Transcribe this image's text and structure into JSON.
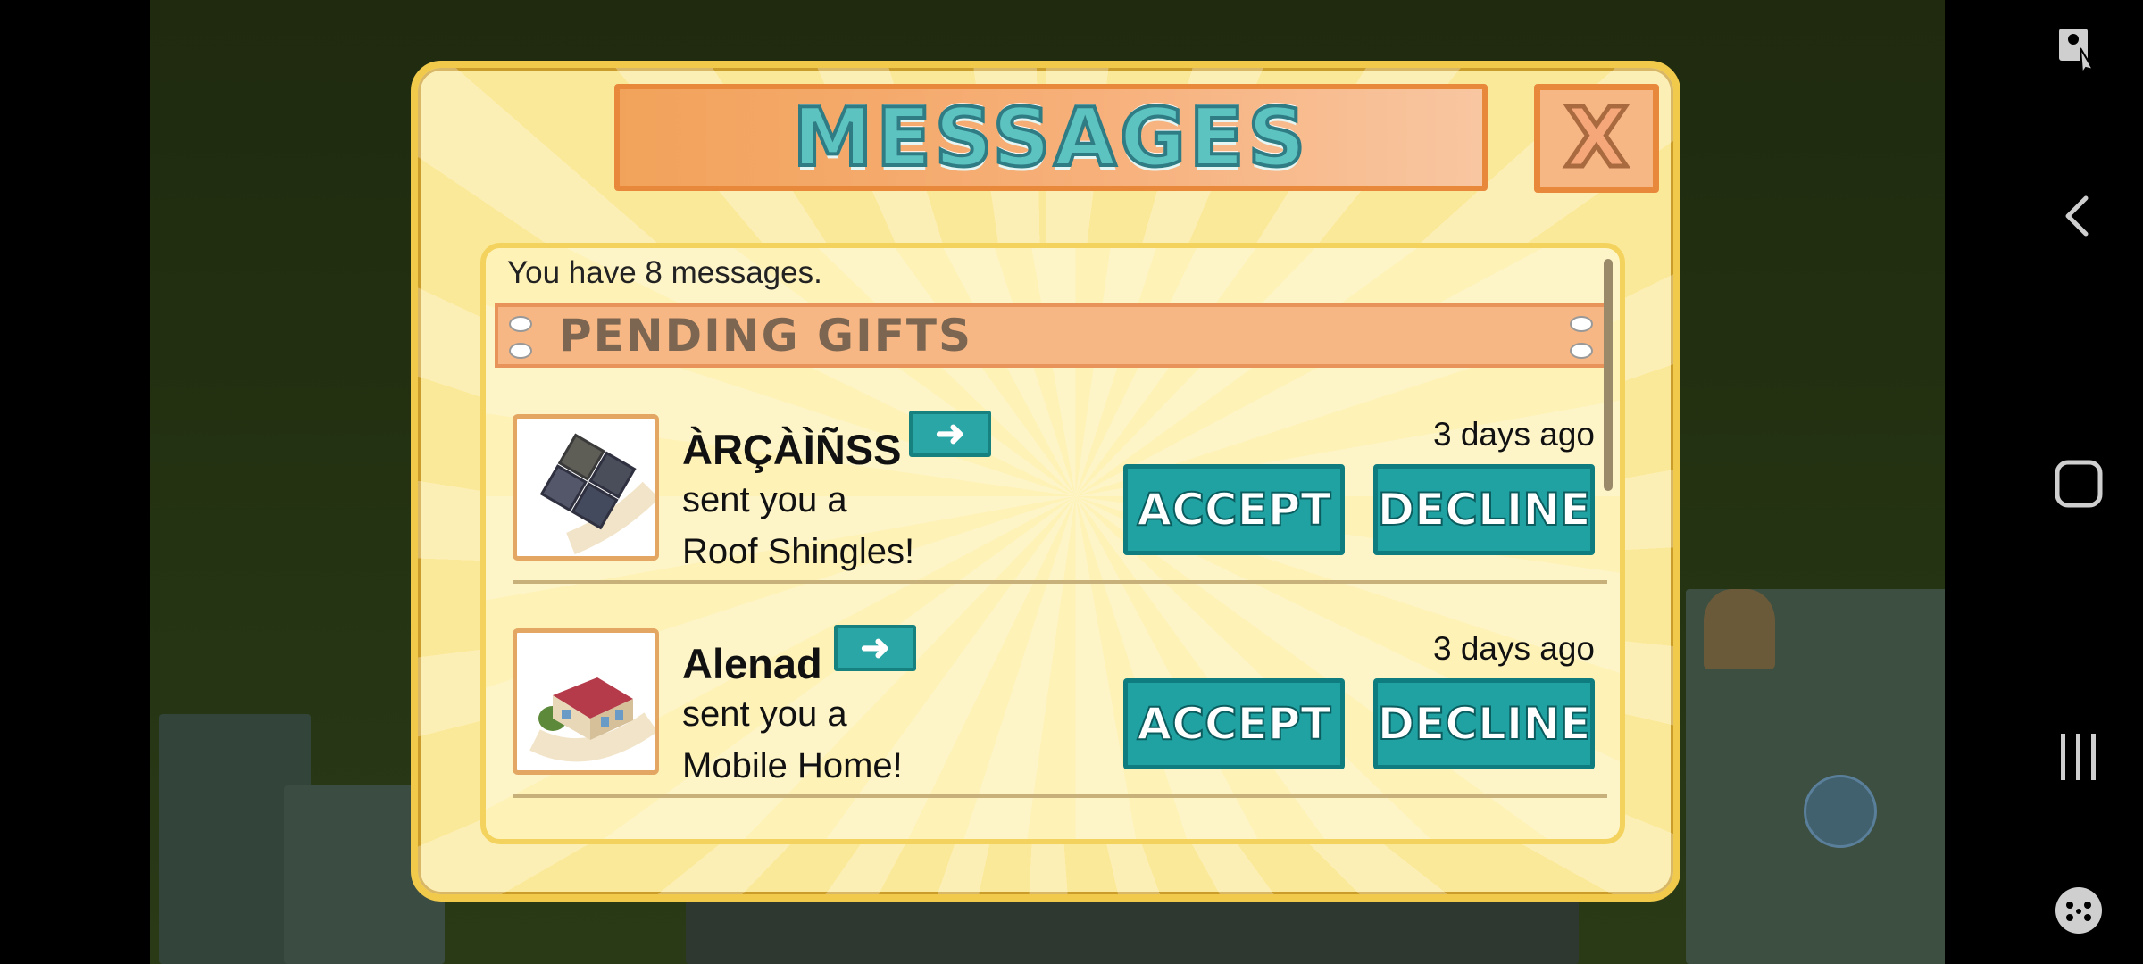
{
  "dialog": {
    "title": "MESSAGES",
    "close_label": "X",
    "count_text": "You have 8 messages.",
    "section_title": "PENDING GIFTS"
  },
  "gifts": [
    {
      "sender": "ÀRÇÀÌÑSS",
      "line1": "sent you a",
      "line2": "Roof Shingles!",
      "time": "3 days ago",
      "accept_label": "ACCEPT",
      "decline_label": "DECLINE",
      "icon": "roof-shingles-icon"
    },
    {
      "sender": "Alenad",
      "line1": "sent you a",
      "line2": "Mobile Home!",
      "time": "3 days ago",
      "accept_label": "ACCEPT",
      "decline_label": "DECLINE",
      "icon": "mobile-home-icon"
    }
  ],
  "colors": {
    "accent_button": "#20a2a2",
    "banner_orange": "#f2a35b",
    "dialog_bg": "#fbe99a"
  },
  "system_icons": [
    "screenshot-touch-icon",
    "back-icon",
    "home-icon",
    "recents-icon",
    "game-launcher-icon"
  ]
}
